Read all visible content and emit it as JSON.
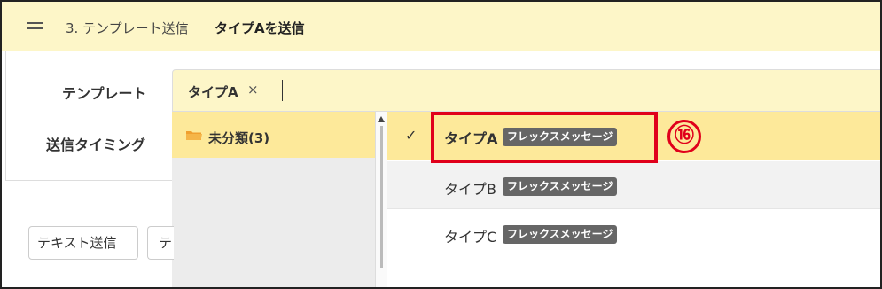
{
  "header": {
    "breadcrumb": "3. テンプレート送信",
    "title": "タイプAを送信"
  },
  "form": {
    "template_label": "テンプレート",
    "timing_label": "送信タイミング",
    "selected_tag": "タイプA",
    "tag_remove": "×"
  },
  "dropdown": {
    "category": {
      "label": "未分類(3)",
      "icon": "folder-icon"
    },
    "items": [
      {
        "name": "タイプA",
        "badge": "フレックスメッセージ",
        "selected": true,
        "check": "✓"
      },
      {
        "name": "タイプB",
        "badge": "フレックスメッセージ",
        "selected": false
      },
      {
        "name": "タイプC",
        "badge": "フレックスメッセージ",
        "selected": false
      }
    ]
  },
  "annotation": {
    "number": "⑯",
    "color": "#e0001b"
  },
  "buttons": {
    "text_send": "テキスト送信",
    "second": "テ"
  },
  "colors": {
    "header_bg": "#fdf6c8",
    "selected_bg": "#fde99a",
    "badge_bg": "#666666",
    "highlight": "#e0001b"
  }
}
